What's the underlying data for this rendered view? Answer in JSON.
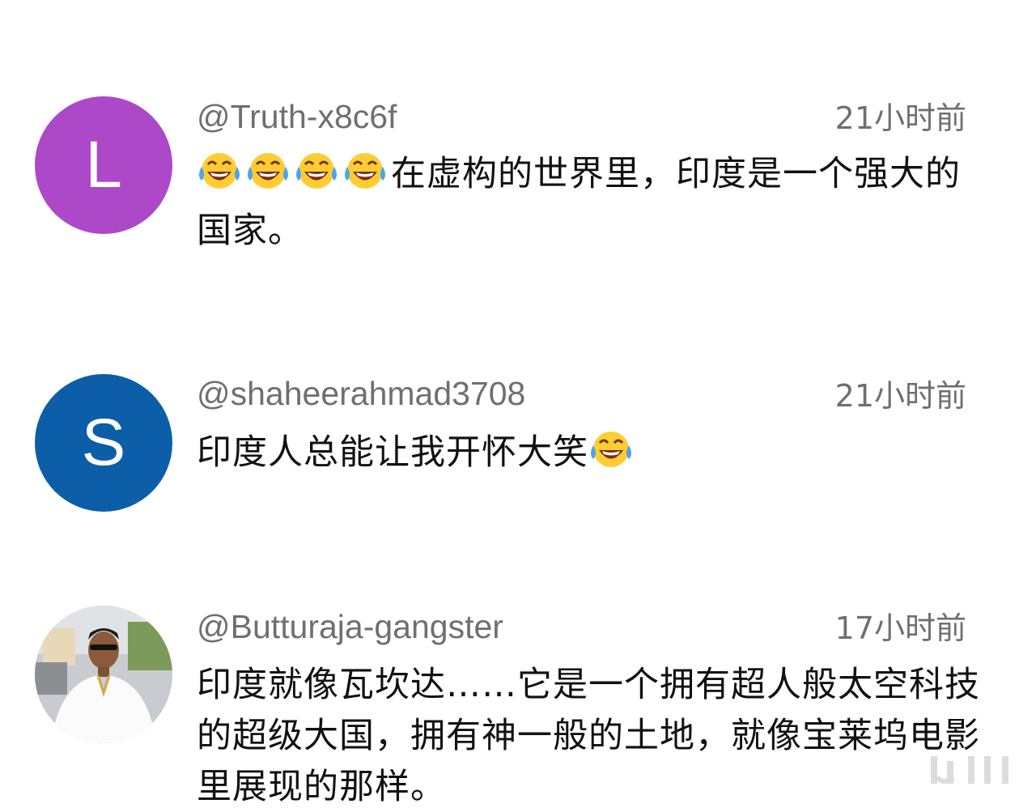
{
  "comments": [
    {
      "username": "@Truth-x8c6f",
      "time": "21小时前",
      "avatar": {
        "letter": "L",
        "color": "#ad48c9"
      },
      "emoji_icons": [
        "face-with-tears-of-joy-icon",
        "face-with-tears-of-joy-icon",
        "face-with-tears-of-joy-icon",
        "face-with-tears-of-joy-icon"
      ],
      "text": "在虚构的世界里，印度是一个强大的国家。"
    },
    {
      "username": "@shaheerahmad3708",
      "time": "21小时前",
      "avatar": {
        "letter": "S",
        "color": "#0d5ea8"
      },
      "text": "印度人总能让我开怀大笑",
      "emoji_icons_after": [
        "face-with-tears-of-joy-icon"
      ]
    },
    {
      "username": "@Butturaja-gangster",
      "time": "17小时前",
      "avatar": {
        "image": "user-photo"
      },
      "text": "印度就像瓦坎达……它是一个拥有超人般太空科技的超级大国，拥有神一般的土地，就像宝莱坞电影里展现的那样。"
    }
  ],
  "colors": {
    "meta_text": "#6f6f6f",
    "body_text": "#111111",
    "background": "#ffffff"
  }
}
